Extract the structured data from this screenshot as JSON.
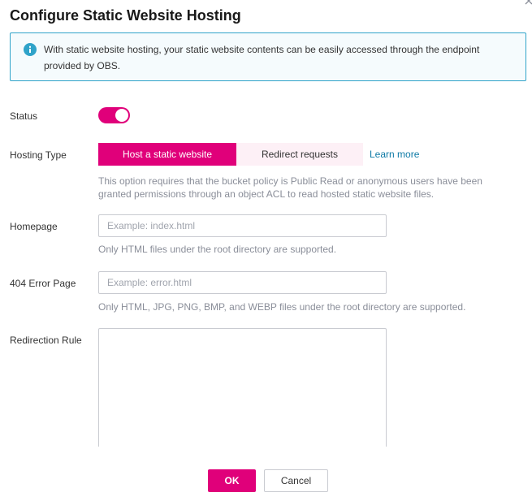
{
  "dialog": {
    "title": "Configure Static Website Hosting",
    "close_icon": "close-icon"
  },
  "info": {
    "icon": "info-icon",
    "text": "With static website hosting, your static website contents can be easily accessed through the endpoint provided by OBS."
  },
  "status": {
    "label": "Status",
    "enabled": true
  },
  "hosting_type": {
    "label": "Hosting Type",
    "options": [
      "Host a static website",
      "Redirect requests"
    ],
    "selected": "Host a static website",
    "learn_more": "Learn more",
    "help": "This option requires that the bucket policy is Public Read or anonymous users have been granted permissions through an object ACL to read hosted static website files."
  },
  "homepage": {
    "label": "Homepage",
    "value": "",
    "placeholder": "Example: index.html",
    "help": "Only HTML files under the root directory are supported."
  },
  "error_page": {
    "label": "404 Error Page",
    "value": "",
    "placeholder": "Example: error.html",
    "help": "Only HTML, JPG, PNG, BMP, and WEBP files under the root directory are supported."
  },
  "redirection_rule": {
    "label": "Redirection Rule",
    "value": ""
  },
  "footer": {
    "ok": "OK",
    "cancel": "Cancel"
  },
  "colors": {
    "accent": "#e0007a",
    "info_border": "#2fa3c9",
    "link": "#0e7aa6"
  }
}
